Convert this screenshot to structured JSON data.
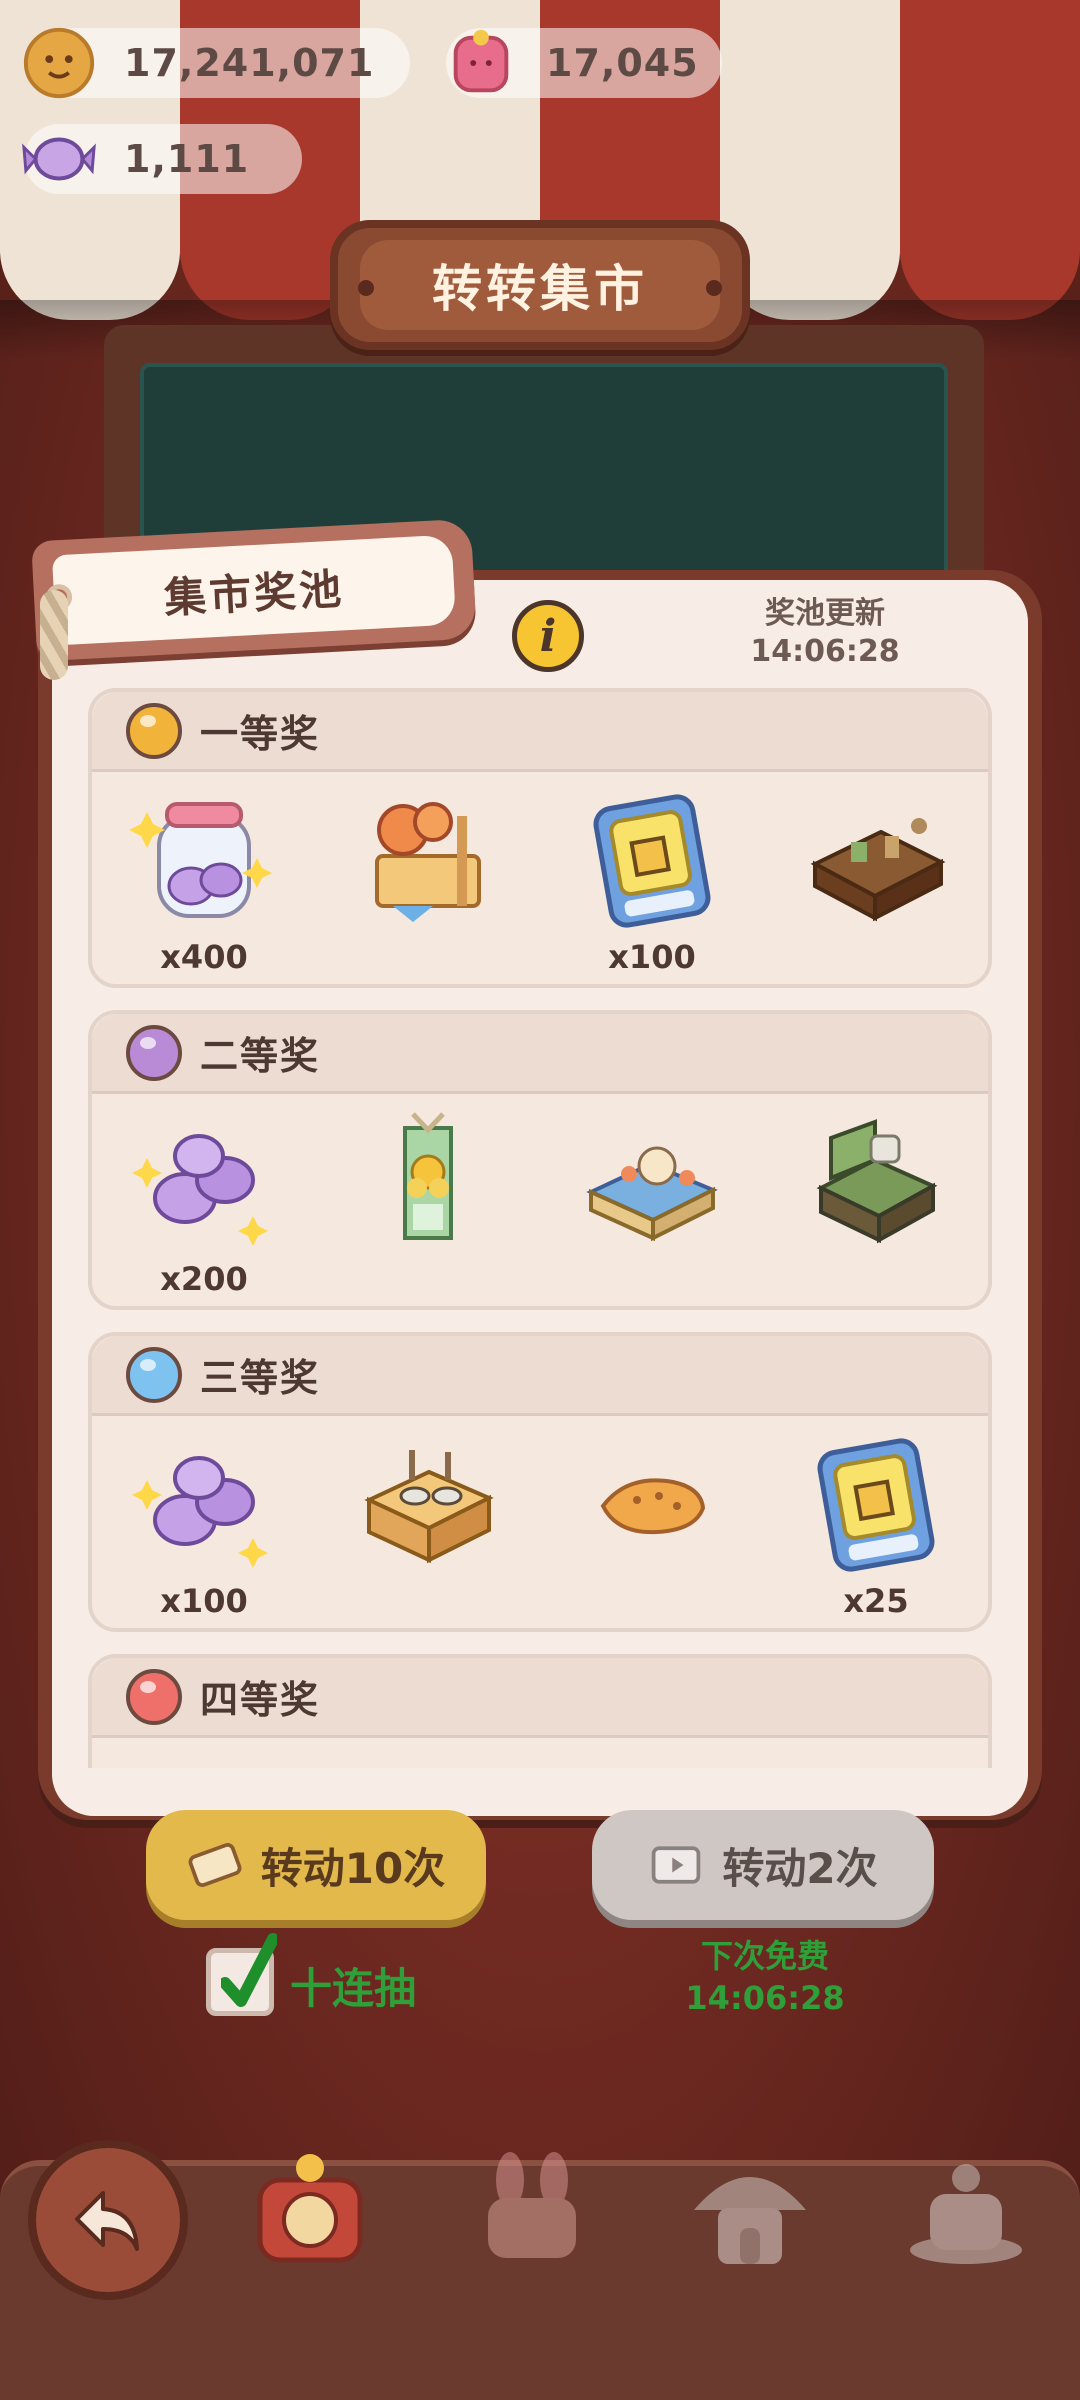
{
  "currency": {
    "cookies": "17,241,071",
    "gems": "17,045",
    "candies": "1,111"
  },
  "title": "转转集市",
  "prize_pool": {
    "tag": "集市奖池",
    "refresh_label": "奖池更新",
    "refresh_time": "14:06:28",
    "tiers": [
      {
        "name": "一等奖",
        "color": "#f2b33a",
        "items": [
          {
            "icon": "candy-jar-icon",
            "qty": "x400"
          },
          {
            "icon": "market-stall-icon",
            "qty": ""
          },
          {
            "icon": "fist-card-icon",
            "qty": "x100"
          },
          {
            "icon": "workbench-icon",
            "qty": ""
          }
        ]
      },
      {
        "name": "二等奖",
        "color": "#b98ad6",
        "items": [
          {
            "icon": "candy-bundle-icon",
            "qty": "x200"
          },
          {
            "icon": "flower-banner-icon",
            "qty": ""
          },
          {
            "icon": "cat-table-icon",
            "qty": ""
          },
          {
            "icon": "armchair-icon",
            "qty": ""
          }
        ]
      },
      {
        "name": "三等奖",
        "color": "#7ec2f0",
        "items": [
          {
            "icon": "candy-bundle-icon",
            "qty": "x100"
          },
          {
            "icon": "cooking-stove-icon",
            "qty": ""
          },
          {
            "icon": "fish-cake-icon",
            "qty": ""
          },
          {
            "icon": "fist-card-icon",
            "qty": "x25"
          }
        ]
      },
      {
        "name": "四等奖",
        "color": "#ef6f6a",
        "items": []
      }
    ]
  },
  "buttons": {
    "spin10": "转动10次",
    "spin2": "转动2次",
    "ten_pull": "十连抽",
    "next_free_label": "下次免费",
    "next_free_time": "14:06:28"
  }
}
